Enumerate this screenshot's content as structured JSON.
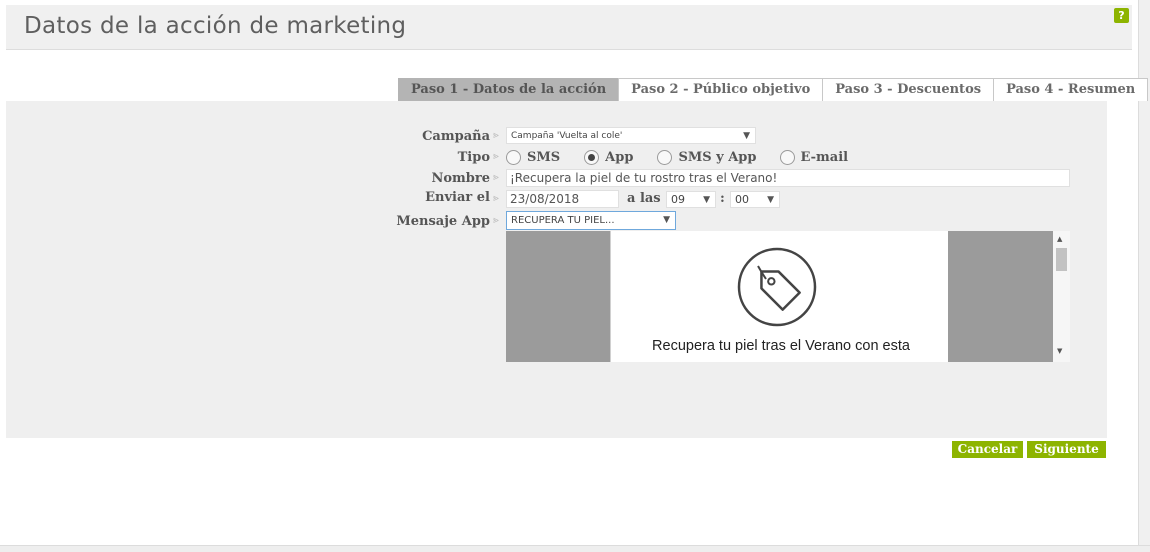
{
  "header": {
    "title": "Datos de la acción de marketing",
    "help_label": "?"
  },
  "tabs": [
    {
      "label": "Paso 1 - Datos de la acción",
      "active": true
    },
    {
      "label": "Paso 2 - Público objetivo",
      "active": false
    },
    {
      "label": "Paso 3 - Descuentos",
      "active": false
    },
    {
      "label": "Paso 4 - Resumen",
      "active": false
    }
  ],
  "form": {
    "separator": "⪢",
    "campaign": {
      "label": "Campaña",
      "value": "Campaña 'Vuelta al cole'"
    },
    "type": {
      "label": "Tipo",
      "options": [
        "SMS",
        "App",
        "SMS y App",
        "E-mail"
      ],
      "selected": "App"
    },
    "name": {
      "label": "Nombre",
      "value": "¡Recupera la piel de tu rostro tras el Verano!"
    },
    "send": {
      "label": "Enviar el",
      "date": "23/08/2018",
      "at_label": "a las",
      "hour": "09",
      "time_sep": ":",
      "minute": "00"
    },
    "app_message": {
      "label": "Mensaje App",
      "value": "RECUPERA TU PIEL..."
    }
  },
  "preview": {
    "message": "Recupera tu piel tras el Verano con esta",
    "icon": "price-tag-icon"
  },
  "actions": {
    "cancel_label": "Cancelar",
    "next_label": "Siguiente"
  },
  "colors": {
    "accent": "#8db400",
    "active_tab": "#b4b4b4",
    "panel": "#efefef"
  }
}
